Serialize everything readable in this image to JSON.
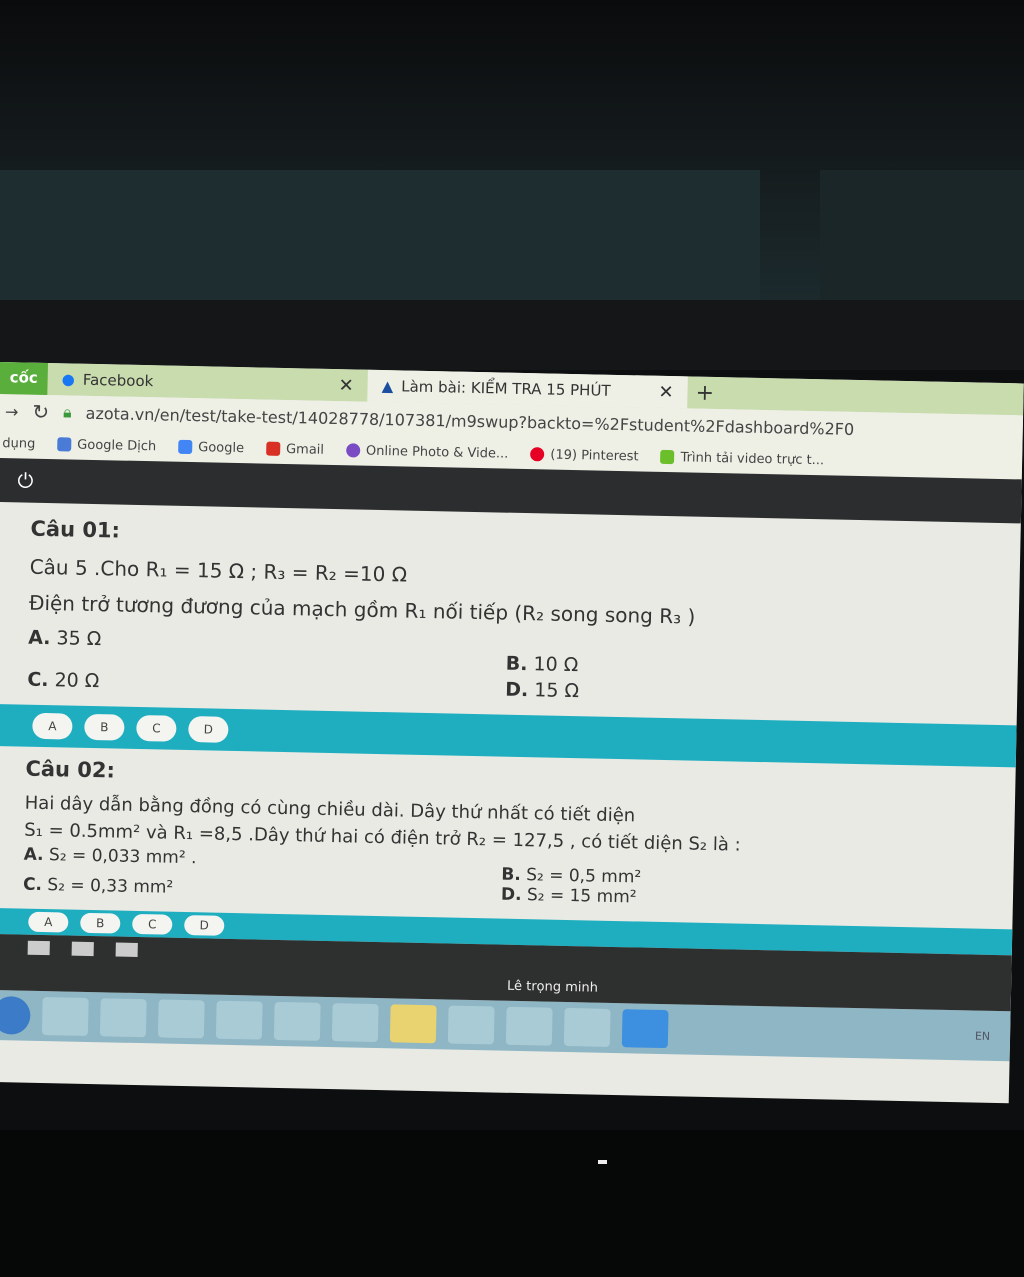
{
  "browser": {
    "tabs": [
      {
        "label": "cốc"
      },
      {
        "label": "Facebook"
      },
      {
        "label": "Làm bài: KIỂM TRA 15 PHÚT"
      }
    ],
    "new_tab": "+",
    "close": "✕",
    "url": "azota.vn/en/test/take-test/14028778/107381/m9swup?backto=%2Fstudent%2Fdashboard%2F0",
    "bookmarks": [
      {
        "label": "dụng",
        "color": ""
      },
      {
        "label": "Google Dịch",
        "color": "#4a7bd6"
      },
      {
        "label": "Google",
        "color": "#4285f4"
      },
      {
        "label": "Gmail",
        "color": "#d93025"
      },
      {
        "label": "Online Photo & Vide...",
        "color": "#7b4bc4"
      },
      {
        "label": "(19) Pinterest",
        "color": "#e60023"
      },
      {
        "label": "Trình tải video trực t...",
        "color": "#6bbf2a"
      }
    ]
  },
  "questions": [
    {
      "title": "Câu 01:",
      "lines": [
        "Câu 5 .Cho R₁ = 15 Ω ; R₃ = R₂ =10 Ω",
        "Điện trở tương đương của mạch gồm R₁ nối tiếp (R₂ song song R₃ )"
      ],
      "options": [
        {
          "key": "A.",
          "text": "35 Ω"
        },
        {
          "key": "B.",
          "text": "10 Ω"
        },
        {
          "key": "C.",
          "text": "20 Ω"
        },
        {
          "key": "D.",
          "text": "15 Ω"
        }
      ]
    },
    {
      "title": "Câu 02:",
      "lines": [
        "Hai dây dẫn bằng đồng có cùng chiều dài. Dây thứ nhất có tiết diện",
        "S₁ = 0.5mm² và R₁ =8,5 .Dây thứ hai có điện trở R₂ = 127,5 , có tiết diện S₂ là :"
      ],
      "options": [
        {
          "key": "A.",
          "text": "S₂ = 0,033 mm² ."
        },
        {
          "key": "B.",
          "text": "S₂ = 0,5 mm²"
        },
        {
          "key": "C.",
          "text": "S₂ = 0,33 mm²"
        },
        {
          "key": "D.",
          "text": "S₂ = 15 mm²"
        }
      ]
    }
  ],
  "answer_buttons": [
    "A",
    "B",
    "C",
    "D"
  ],
  "user_name": "Lê trọng minh",
  "taskbar": {
    "lang": "EN"
  },
  "colors": {
    "accent": "#1faec0",
    "tab_bar": "#c9dcae",
    "top_bar": "#2b2d2e"
  }
}
